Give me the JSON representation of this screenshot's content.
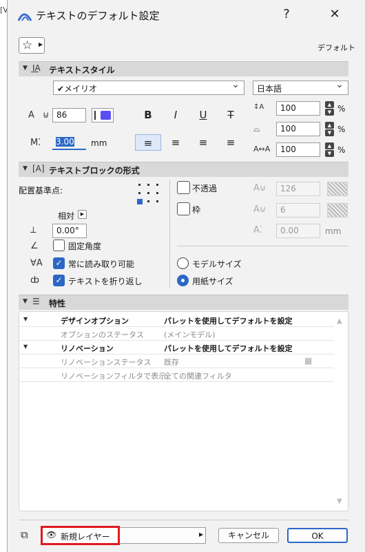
{
  "window": {
    "title": "テキストのデフォルト設定",
    "help_label": "?",
    "close_label": "✕",
    "bg_text": "[V"
  },
  "toolbar": {
    "favorite_icon": "star-icon",
    "default_label": "デフォルト"
  },
  "text_style": {
    "header": "テキストスタイル",
    "font_value": "✔メイリオ",
    "language_value": "日本語",
    "size_value": "86",
    "width_value": "3.00",
    "width_unit": "mm",
    "spacing": [
      {
        "value": "100",
        "unit": "%"
      },
      {
        "value": "100",
        "unit": "%"
      },
      {
        "value": "100",
        "unit": "%"
      }
    ],
    "bold_label": "B",
    "italic_label": "I",
    "underline_label": "U",
    "strike_label": "T",
    "color_swatch": "#5a4ff2"
  },
  "text_block": {
    "header": "テキストブロックの形式",
    "anchor_label": "配置基準点:",
    "relative_label": "相対",
    "angle_value": "0.00°",
    "fixed_angle_label": "固定角度",
    "always_readable_label": "常に読み取り可能",
    "wrap_label": "テキストを折り返し",
    "opaque_label": "不透過",
    "frame_label": "枠",
    "fill_pen_value": "126",
    "frame_pen_value": "6",
    "offset_value": "0.00",
    "offset_unit": "mm",
    "model_size_label": "モデルサイズ",
    "paper_size_label": "用紙サイズ"
  },
  "properties": {
    "header": "特性",
    "rows": [
      {
        "name": "デザインオプション",
        "value": "パレットを使用してデフォルトを設定",
        "kind": "hdr"
      },
      {
        "name": "オプションのステータス",
        "value": "(メインモデル)",
        "kind": "sub"
      },
      {
        "name": "リノベーション",
        "value": "パレットを使用してデフォルトを設定",
        "kind": "hdr"
      },
      {
        "name": "リノベーションステータス",
        "value": "既存",
        "kind": "sub"
      },
      {
        "name": "リノベーションフィルタで表示",
        "value": "全ての関連フィルタ",
        "kind": "sub"
      }
    ]
  },
  "footer": {
    "layer_value": "新規レイヤー",
    "cancel_label": "キャンセル",
    "ok_label": "OK",
    "highlight_color": "#e0191e"
  }
}
